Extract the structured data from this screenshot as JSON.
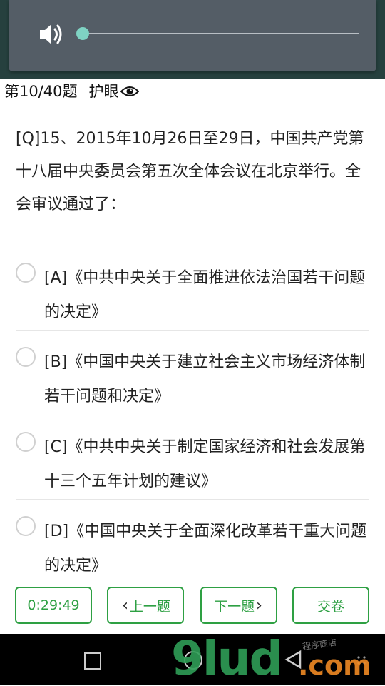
{
  "player": {
    "progress": 0.0,
    "icon": "speaker-icon"
  },
  "header": {
    "progress_text": "第10/40题",
    "eye_mode_label": "护眼",
    "eye_icon": "eye-icon"
  },
  "question": {
    "text": "[Q]15、2015年10月26日至29日，中国共产党第十八届中央委员会第五次全体会议在北京举行。全会审议通过了："
  },
  "options": [
    {
      "label": "[A]《中共中央关于全面推进依法治国若干问题的决定》",
      "selected": false
    },
    {
      "label": "[B]《中国中央关于建立社会主义市场经济体制若干问题和决定》",
      "selected": false
    },
    {
      "label": "[C]《中共中央关于制定国家经济和社会发展第十三个五年计划的建议》",
      "selected": false
    },
    {
      "label": "[D]《中国中央关于全面深化改革若干重大问题的决定》",
      "selected": false
    }
  ],
  "footer": {
    "timer": "0:29:49",
    "prev_label": "上一题",
    "next_label": "下一题",
    "submit_label": "交卷"
  },
  "colors": {
    "accent": "#2ea043",
    "slider": "#7fd3c3",
    "player_bg": "#545d66",
    "top_bg": "#26403e"
  },
  "watermark": {
    "big": "9lud",
    "com": ".com",
    "cn": "程序商店"
  }
}
